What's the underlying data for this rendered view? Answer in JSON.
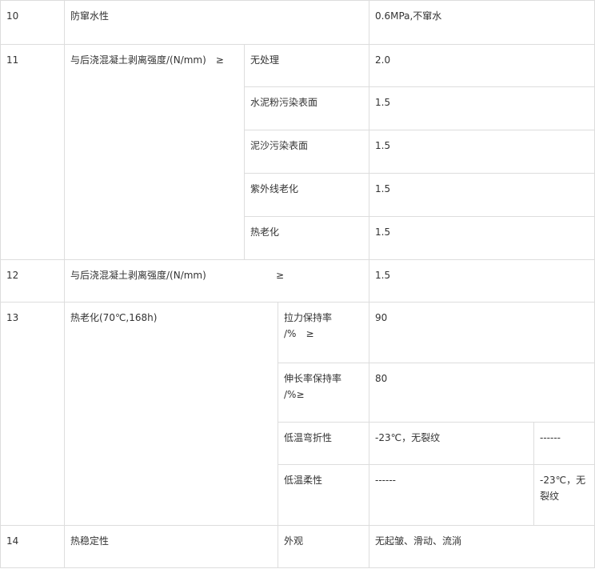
{
  "rows": {
    "r10": {
      "no": "10",
      "item": "防窜水性",
      "value": "0.6MPa,不窜水"
    },
    "r11": {
      "no": "11",
      "item": "与后浇混凝土剥离强度/(N/mm)　≥",
      "subs": [
        {
          "label": "无处理",
          "value": "2.0"
        },
        {
          "label": "水泥粉污染表面",
          "value": "1.5"
        },
        {
          "label": "泥沙污染表面",
          "value": "1.5"
        },
        {
          "label": "紫外线老化",
          "value": "1.5"
        },
        {
          "label": "热老化",
          "value": "1.5"
        }
      ]
    },
    "r12": {
      "no": "12",
      "item": "与后浇混凝土剥离强度/(N/mm)",
      "ge": "≥",
      "value": "1.5"
    },
    "r13": {
      "no": "13",
      "item": "热老化(70℃,168h)",
      "tensile": {
        "label_l1": "拉力保持率",
        "label_l2": "/%　≥",
        "value": "90"
      },
      "elong": {
        "label_l1": "伸长率保持率",
        "label_l2": "/%≥",
        "value": "80"
      },
      "lowbend": {
        "label": "低温弯折性",
        "v1": "-23℃，无裂纹",
        "v2": "------"
      },
      "lowflex": {
        "label": "低温柔性",
        "v1": "------",
        "v2_l1": "-23℃，无",
        "v2_l2": "裂纹"
      }
    },
    "r14": {
      "no": "14",
      "item": "热稳定性",
      "sub": "外观",
      "value": "无起皱、滑动、流淌"
    }
  }
}
